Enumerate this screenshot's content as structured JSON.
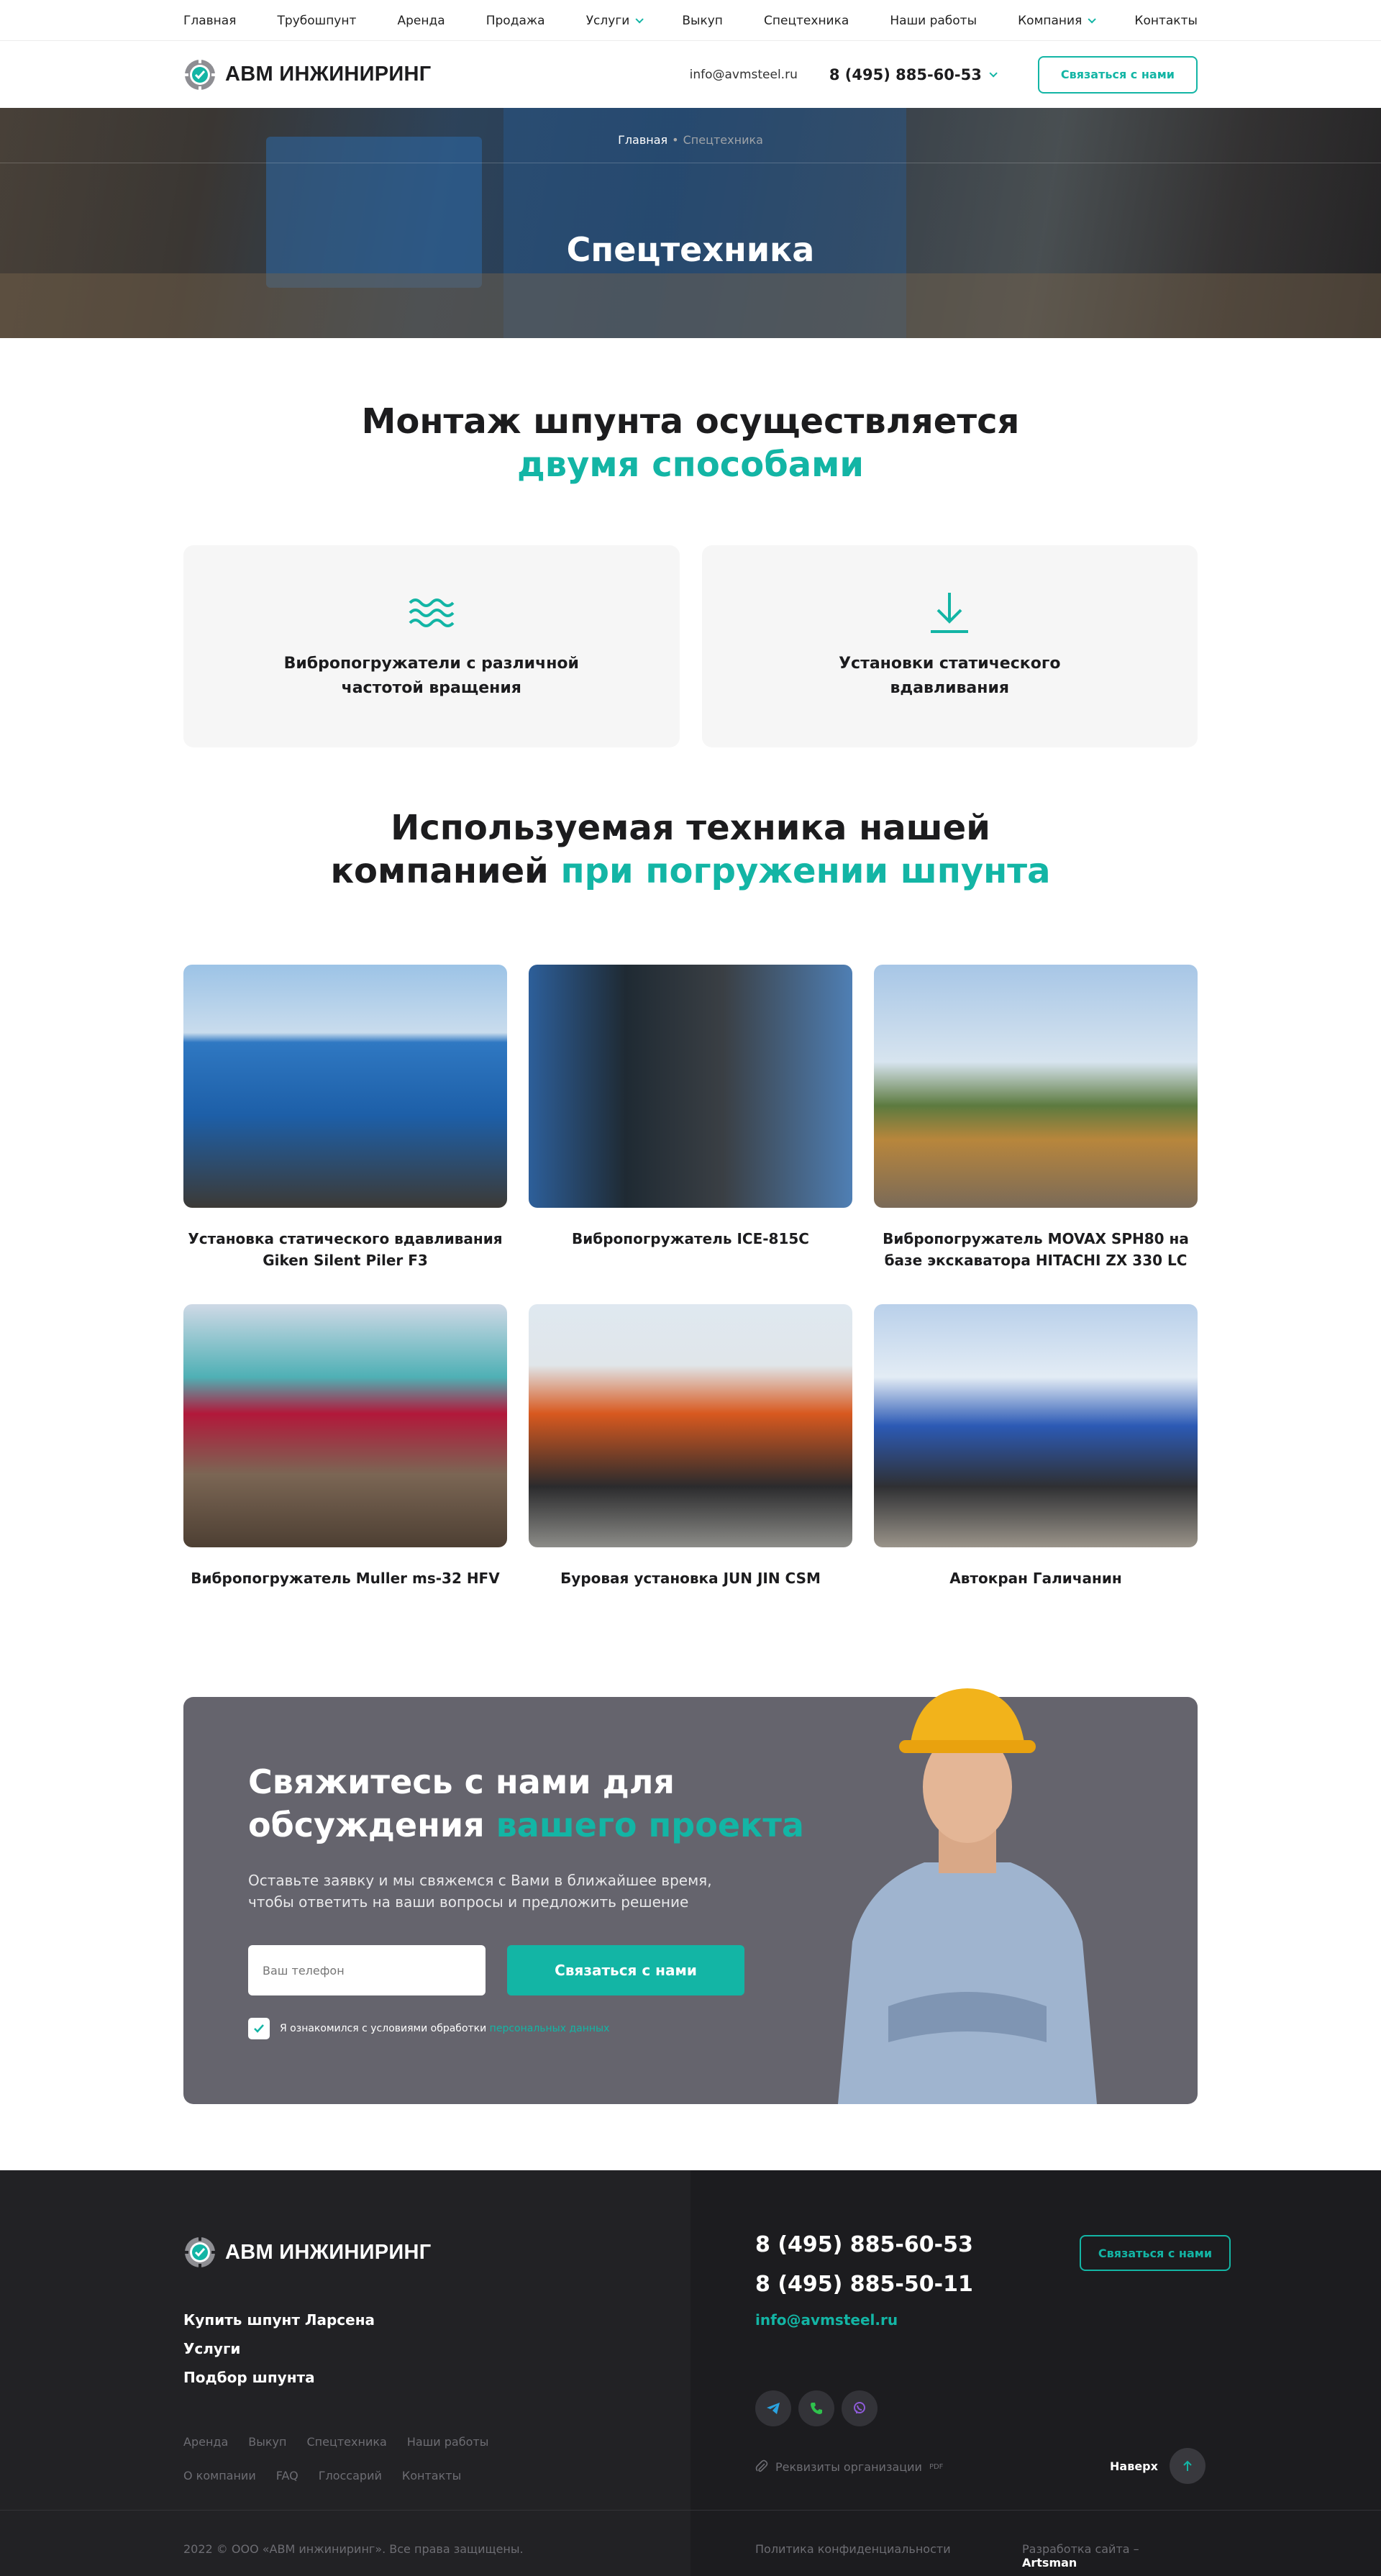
{
  "topnav": {
    "items": [
      "Главная",
      "Трубошпунт",
      "Аренда",
      "Продажа",
      "Услуги",
      "Выкуп",
      "Спецтехника",
      "Наши работы",
      "Компания",
      "Контакты"
    ]
  },
  "header": {
    "logo": "АВМ ИНЖИНИРИНГ",
    "email": "info@avmsteel.ru",
    "phone": "8 (495) 885-60-53",
    "cta": "Связаться с нами"
  },
  "hero": {
    "crumb_home": "Главная",
    "crumb_current": "Спецтехника",
    "title": "Спецтехника"
  },
  "methods": {
    "title_line1": "Монтаж шпунта осуществляется",
    "title_accent": "двумя способами",
    "items": [
      {
        "label": "Вибропогружатели с различной частотой вращения",
        "icon": "waves-icon"
      },
      {
        "label": "Установки статического вдавливания",
        "icon": "download-arrow-icon"
      }
    ]
  },
  "equipment": {
    "title_line1": "Используемая техника нашей",
    "title_plain2": "компанией",
    "title_accent": "при погружении шпунта",
    "items": [
      {
        "caption": "Установка статического вдавливания Giken Silent Piler F3"
      },
      {
        "caption": "Вибропогружатель ICE-815C"
      },
      {
        "caption": "Вибропогружатель MOVAX SPH80 на базе экскаватора HITACHI ZX 330 LC"
      },
      {
        "caption": "Вибропогружатель Muller ms-32 HFV"
      },
      {
        "caption": "Буровая установка JUN JIN CSM"
      },
      {
        "caption": "Автокран Галичанин"
      }
    ]
  },
  "contact": {
    "title_line1": "Свяжитесь с нами для",
    "title_plain2": "обсуждения",
    "title_accent": "вашего проекта",
    "desc_line1": "Оставьте заявку и мы свяжемся с Вами в ближайшее время,",
    "desc_line2": "чтобы ответить на ваши вопросы и предложить решение",
    "phone_placeholder": "Ваш телефон",
    "submit": "Связаться с нами",
    "agree_text": "Я ознакомился с условиями обработки",
    "agree_link": "персональных данных"
  },
  "footer": {
    "logo": "АВМ ИНЖИНИРИНГ",
    "main_links": [
      "Купить шпунт Ларсена",
      "Услуги",
      "Подбор шпунта"
    ],
    "sub_links": [
      "Аренда",
      "Выкуп",
      "Спецтехника",
      "Наши работы",
      "О компании",
      "FAQ",
      "Глоссарий",
      "Контакты"
    ],
    "phone1": "8 (495) 885-60-53",
    "phone2": "8 (495) 885-50-11",
    "email": "info@avmsteel.ru",
    "cta": "Связаться с нами",
    "requisites": "Реквизиты организации",
    "requisites_badge": "PDF",
    "to_top": "Наверх",
    "copyright": "2022 © ООО «АВМ инжиниринг». Все права защищены.",
    "privacy": "Политика конфиденциальности",
    "dev_prefix": "Разработка сайта –",
    "dev_name": "Artsman"
  },
  "colors": {
    "accent": "#13b5a5",
    "dark": "#222225",
    "contact_bg": "#65646d"
  }
}
